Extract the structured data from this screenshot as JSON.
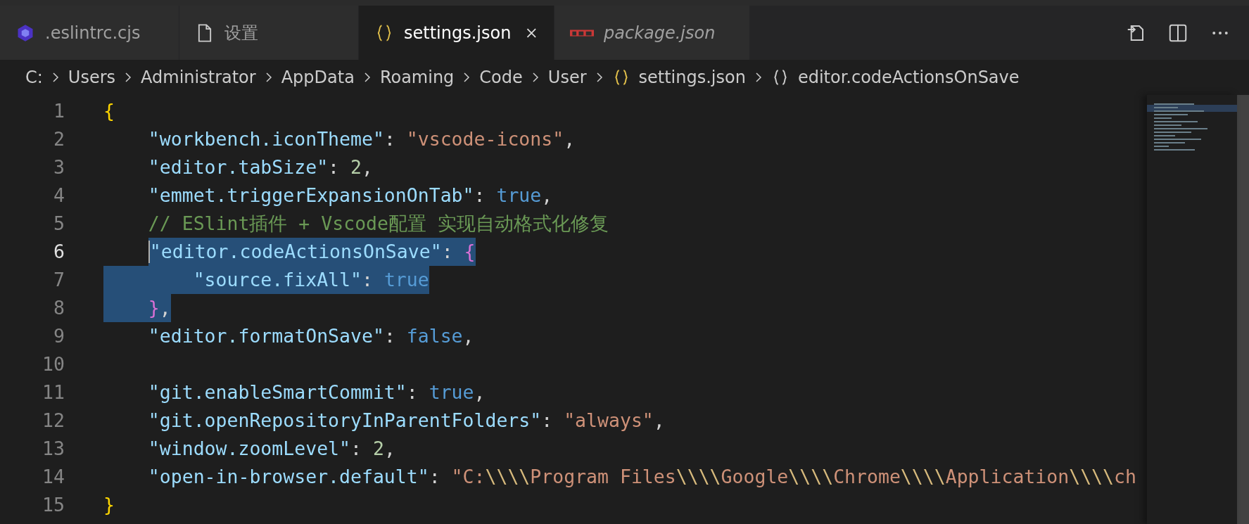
{
  "tabs": [
    {
      "label": ".eslintrc.cjs",
      "kind": "eslint",
      "selected": false,
      "preview": false
    },
    {
      "label": "设置",
      "kind": "file",
      "selected": false,
      "preview": false
    },
    {
      "label": "settings.json",
      "kind": "braces",
      "selected": true,
      "preview": false
    },
    {
      "label": "package.json",
      "kind": "npm",
      "selected": false,
      "preview": true
    }
  ],
  "breadcrumbs": [
    {
      "label": "C:",
      "kind": "folder"
    },
    {
      "label": "Users",
      "kind": "folder"
    },
    {
      "label": "Administrator",
      "kind": "folder"
    },
    {
      "label": "AppData",
      "kind": "folder"
    },
    {
      "label": "Roaming",
      "kind": "folder"
    },
    {
      "label": "Code",
      "kind": "folder"
    },
    {
      "label": "User",
      "kind": "folder"
    },
    {
      "label": "settings.json",
      "kind": "file"
    },
    {
      "label": "editor.codeActionsOnSave",
      "kind": "symbol"
    }
  ],
  "editor": {
    "lines": [
      {
        "number": "1",
        "current": false,
        "selected": false,
        "tokens": [
          {
            "kind": "brace1",
            "text": "{"
          }
        ]
      },
      {
        "number": "2",
        "current": false,
        "selected": false,
        "tokens": [
          {
            "kind": "key",
            "text": "    \"workbench.iconTheme\""
          },
          {
            "kind": "punc",
            "text": ": "
          },
          {
            "kind": "str",
            "text": "\"vscode-icons\""
          },
          {
            "kind": "punc",
            "text": ","
          }
        ]
      },
      {
        "number": "3",
        "current": false,
        "selected": false,
        "tokens": [
          {
            "kind": "key",
            "text": "    \"editor.tabSize\""
          },
          {
            "kind": "punc",
            "text": ": "
          },
          {
            "kind": "num",
            "text": "2"
          },
          {
            "kind": "punc",
            "text": ","
          }
        ]
      },
      {
        "number": "4",
        "current": false,
        "selected": false,
        "tokens": [
          {
            "kind": "key",
            "text": "    \"emmet.triggerExpansionOnTab\""
          },
          {
            "kind": "punc",
            "text": ": "
          },
          {
            "kind": "bool",
            "text": "true"
          },
          {
            "kind": "punc",
            "text": ","
          }
        ]
      },
      {
        "number": "5",
        "current": false,
        "selected": false,
        "tokens": [
          {
            "kind": "comment",
            "text": "    // ESlint插件 + Vscode配置 实现自动格式化修复"
          }
        ]
      },
      {
        "number": "6",
        "current": true,
        "selected": true,
        "tokens": [
          {
            "kind": "key",
            "text": "    \"editor.codeActionsOnSave\""
          },
          {
            "kind": "punc",
            "text": ": "
          },
          {
            "kind": "brace2",
            "text": "{"
          }
        ]
      },
      {
        "number": "7",
        "current": false,
        "selected": true,
        "tokens": [
          {
            "kind": "key",
            "text": "        \"source.fixAll\""
          },
          {
            "kind": "punc",
            "text": ": "
          },
          {
            "kind": "bool",
            "text": "true"
          }
        ]
      },
      {
        "number": "8",
        "current": false,
        "selected": true,
        "tokens": [
          {
            "kind": "brace2",
            "text": "    }"
          },
          {
            "kind": "punc",
            "text": ","
          }
        ]
      },
      {
        "number": "9",
        "current": false,
        "selected": false,
        "tokens": [
          {
            "kind": "key",
            "text": "    \"editor.formatOnSave\""
          },
          {
            "kind": "punc",
            "text": ": "
          },
          {
            "kind": "bool",
            "text": "false"
          },
          {
            "kind": "punc",
            "text": ","
          }
        ]
      },
      {
        "number": "10",
        "current": false,
        "selected": false
      },
      {
        "number": "11",
        "current": false,
        "selected": false,
        "tokens": [
          {
            "kind": "key",
            "text": "    \"git.enableSmartCommit\""
          },
          {
            "kind": "punc",
            "text": ": "
          },
          {
            "kind": "bool",
            "text": "true"
          },
          {
            "kind": "punc",
            "text": ","
          }
        ]
      },
      {
        "number": "12",
        "current": false,
        "selected": false,
        "tokens": [
          {
            "kind": "key",
            "text": "    \"git.openRepositoryInParentFolders\""
          },
          {
            "kind": "punc",
            "text": ": "
          },
          {
            "kind": "str",
            "text": "\"always\""
          },
          {
            "kind": "punc",
            "text": ","
          }
        ]
      },
      {
        "number": "13",
        "current": false,
        "selected": false,
        "tokens": [
          {
            "kind": "key",
            "text": "    \"window.zoomLevel\""
          },
          {
            "kind": "punc",
            "text": ": "
          },
          {
            "kind": "num",
            "text": "2"
          },
          {
            "kind": "punc",
            "text": ","
          }
        ]
      },
      {
        "number": "14",
        "current": false,
        "selected": false,
        "tokens": [
          {
            "kind": "key",
            "text": "    \"open-in-browser.default\""
          },
          {
            "kind": "punc",
            "text": ": "
          },
          {
            "kind": "str",
            "text": "\"C:"
          },
          {
            "kind": "esc",
            "text": "\\\\\\\\"
          },
          {
            "kind": "str",
            "text": "Program Files"
          },
          {
            "kind": "esc",
            "text": "\\\\\\\\"
          },
          {
            "kind": "str",
            "text": "Google"
          },
          {
            "kind": "esc",
            "text": "\\\\\\\\"
          },
          {
            "kind": "str",
            "text": "Chrome"
          },
          {
            "kind": "esc",
            "text": "\\\\\\\\"
          },
          {
            "kind": "str",
            "text": "Application"
          },
          {
            "kind": "esc",
            "text": "\\\\\\\\"
          },
          {
            "kind": "str",
            "text": "ch"
          }
        ]
      },
      {
        "number": "15",
        "current": false,
        "selected": false,
        "tokens": [
          {
            "kind": "brace1",
            "text": "}"
          }
        ]
      }
    ]
  }
}
